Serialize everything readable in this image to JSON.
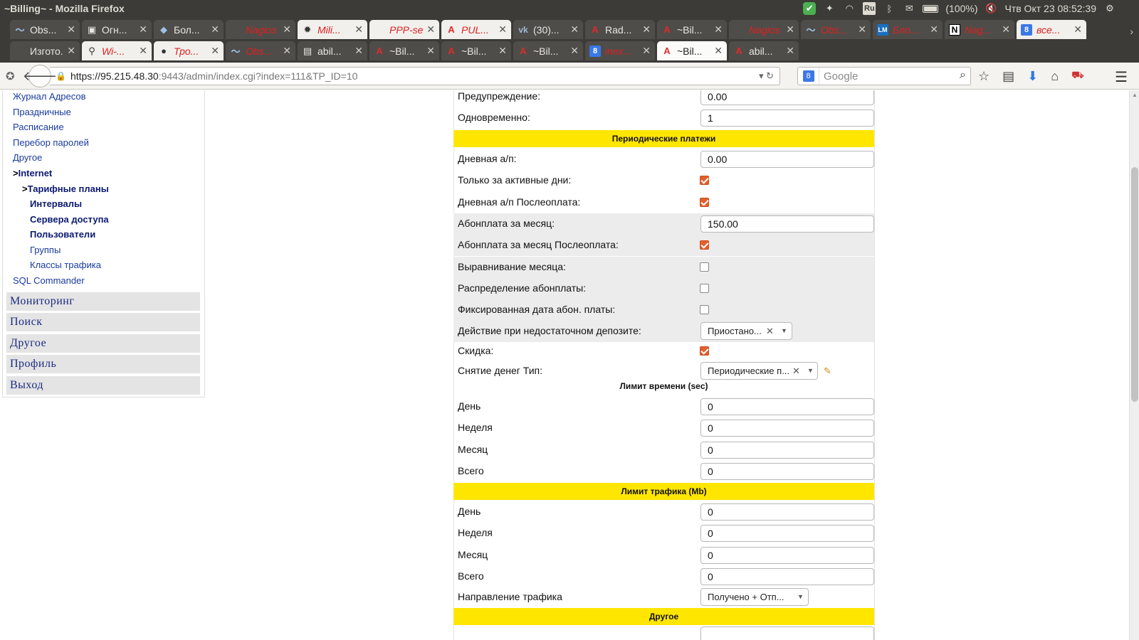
{
  "window": {
    "title": "~Billing~ - Mozilla Firefox"
  },
  "tray": {
    "battery": "(100%)",
    "clock": "Чтв Окт 23 08:52:39",
    "keyboard": "Ru"
  },
  "tabs_row1": [
    {
      "label": "Obs...",
      "fav": "〜",
      "favclass": "wave",
      "style": "dark",
      "red": false
    },
    {
      "label": "Огн...",
      "fav": "▣",
      "favclass": "",
      "style": "dark",
      "red": false
    },
    {
      "label": "Бол...",
      "fav": "◆",
      "favclass": "wave",
      "style": "dark",
      "red": false
    },
    {
      "label": "Nagios ...",
      "fav": "",
      "favclass": "",
      "style": "dark",
      "red": true
    },
    {
      "label": "Mili...",
      "fav": "✹",
      "favclass": "",
      "style": "light",
      "red": true
    },
    {
      "label": "PPP-se...",
      "fav": "",
      "favclass": "",
      "style": "light",
      "red": true
    },
    {
      "label": "PUL...",
      "fav": "A",
      "favclass": "a",
      "style": "light",
      "red": true
    },
    {
      "label": "(30)...",
      "fav": "vk",
      "favclass": "vk",
      "style": "dark",
      "red": false
    },
    {
      "label": "Rad...",
      "fav": "A",
      "favclass": "a",
      "style": "dark",
      "red": false
    },
    {
      "label": "~Bil...",
      "fav": "A",
      "favclass": "a",
      "style": "dark",
      "red": false
    },
    {
      "label": "Nagios ...",
      "fav": "",
      "favclass": "",
      "style": "dark",
      "red": true
    },
    {
      "label": "Obs...",
      "fav": "〜",
      "favclass": "wave",
      "style": "dark",
      "red": true
    },
    {
      "label": "Бло...",
      "fav": "LM",
      "favclass": "lm",
      "style": "dark",
      "red": true
    },
    {
      "label": "Nag...",
      "fav": "N",
      "favclass": "n",
      "style": "dark",
      "red": true
    },
    {
      "label": "все...",
      "fav": "8",
      "favclass": "g",
      "style": "light",
      "red": true
    }
  ],
  "tabs_row2": [
    {
      "label": "Изгото...",
      "fav": "",
      "favclass": "",
      "style": "dark",
      "red": false
    },
    {
      "label": "Wi-...",
      "fav": "⚲",
      "favclass": "",
      "style": "light",
      "red": true
    },
    {
      "label": "Тро...",
      "fav": "●",
      "favclass": "",
      "style": "light",
      "red": true
    },
    {
      "label": "Obs...",
      "fav": "〜",
      "favclass": "wave",
      "style": "dark",
      "red": true
    },
    {
      "label": "abil...",
      "fav": "▤",
      "favclass": "",
      "style": "dark",
      "red": false
    },
    {
      "label": "~Bil...",
      "fav": "A",
      "favclass": "a",
      "style": "dark",
      "red": false
    },
    {
      "label": "~Bil...",
      "fav": "A",
      "favclass": "a",
      "style": "dark",
      "red": false
    },
    {
      "label": "~Bil...",
      "fav": "A",
      "favclass": "a",
      "style": "dark",
      "red": false
    },
    {
      "label": "inex...",
      "fav": "8",
      "favclass": "g",
      "style": "dark",
      "red": true
    },
    {
      "label": "~Bil...",
      "fav": "A",
      "favclass": "a",
      "style": "active",
      "red": false
    },
    {
      "label": "abil...",
      "fav": "A",
      "favclass": "a",
      "style": "dark",
      "red": false
    }
  ],
  "nav": {
    "url_host": "https://95.215.48.30",
    "url_rest": ":9443/admin/index.cgi?index=111&TP_ID=10",
    "search_placeholder": "Google"
  },
  "sidebar": {
    "links": [
      {
        "label": "Журнал Адресов",
        "name": "sidebar-link-address-log"
      },
      {
        "label": "Праздничные",
        "name": "sidebar-link-holidays"
      },
      {
        "label": "Расписание",
        "name": "sidebar-link-schedule"
      },
      {
        "label": "Перебор паролей",
        "name": "sidebar-link-password-bruteforce"
      },
      {
        "label": "Другое",
        "name": "sidebar-link-other"
      }
    ],
    "internet": "Internet",
    "tariffs": "Тарифные планы",
    "sub": [
      {
        "label": "Интервалы",
        "bold": true,
        "name": "sidebar-link-intervals"
      },
      {
        "label": "Сервера доступа",
        "bold": true,
        "name": "sidebar-link-access-servers"
      },
      {
        "label": "Пользователи",
        "bold": true,
        "name": "sidebar-link-users"
      },
      {
        "label": "Группы",
        "bold": false,
        "name": "sidebar-link-groups"
      },
      {
        "label": "Классы трафика",
        "bold": false,
        "name": "sidebar-link-traffic-classes"
      }
    ],
    "sql": "SQL Commander",
    "menus": [
      "Мониторинг",
      "Поиск",
      "Другое",
      "Профиль",
      "Выход"
    ]
  },
  "form": {
    "warning_label": "Предупреждение:",
    "warning_value": "0.00",
    "simul_label": "Одновременно:",
    "simul_value": "1",
    "periodic_header": "Периодические платежи",
    "day_fee_label": "Дневная а/п:",
    "day_fee_value": "0.00",
    "active_days_label": "Только за активные дни:",
    "day_fee_post_label": "Дневная а/п Послеоплата:",
    "month_fee_label": "Абонплата за месяц:",
    "month_fee_value": "150.00",
    "month_fee_post_label": "Абонплата за месяц Послеоплата:",
    "month_align_label": "Выравнивание месяца:",
    "fee_distribution_label": "Распределение абонплаты:",
    "fixed_date_label": "Фиксированная дата абон. платы:",
    "low_deposit_label": "Действие при недостаточном депозите:",
    "low_deposit_value": "Приостано...",
    "discount_label": "Скидка:",
    "withdraw_label": "Снятие денег Тип:",
    "withdraw_value": "Периодические п...",
    "time_limit_header": "Лимит времени (sec)",
    "time_day_label": "День",
    "time_day_value": "0",
    "time_week_label": "Неделя",
    "time_week_value": "0",
    "time_month_label": "Месяц",
    "time_month_value": "0",
    "time_total_label": "Всего",
    "time_total_value": "0",
    "traffic_limit_header": "Лимит трафика (Mb)",
    "tr_day_label": "День",
    "tr_day_value": "0",
    "tr_week_label": "Неделя",
    "tr_week_value": "0",
    "tr_month_label": "Месяц",
    "tr_month_value": "0",
    "tr_total_label": "Всего",
    "tr_total_value": "0",
    "direction_label": "Направление трафика",
    "direction_value": "Получено + Отп...",
    "other_header": "Другое"
  },
  "colors": {
    "accent_header": "#ffe600",
    "checkbox_checked": "#e35f2c",
    "link": "#1a3aa0"
  }
}
